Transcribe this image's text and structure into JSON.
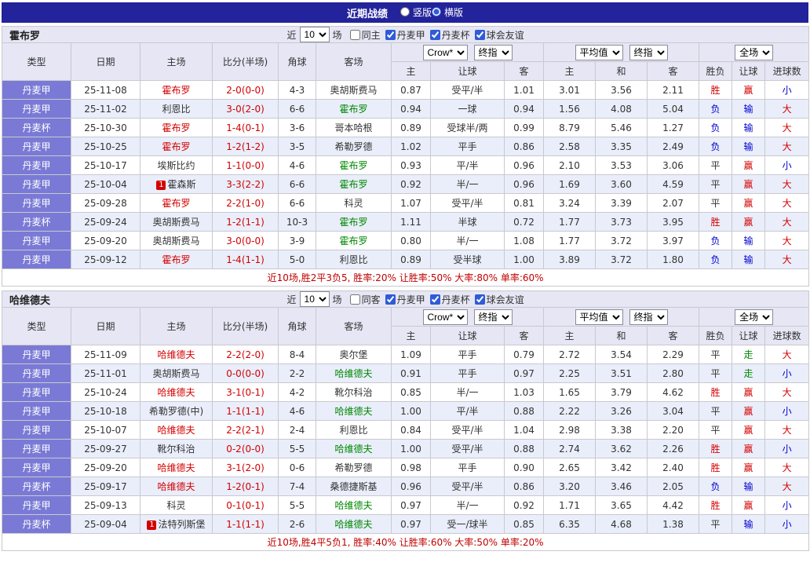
{
  "colors": {
    "topbar_bg": "#23239b",
    "type_cell_bg": "#7a7ad6",
    "header_bg": "#e6e6f4",
    "row_alt_bg": "#e9eefa",
    "red": "#d40000",
    "blue": "#0000cc",
    "green": "#008800",
    "dark": "#333333",
    "summary": "#c00000"
  },
  "topbar": {
    "title": "近期战绩",
    "radios": [
      {
        "label": "竖版",
        "checked": false
      },
      {
        "label": "横版",
        "checked": true
      }
    ]
  },
  "tables": [
    {
      "team": "霍布罗",
      "filter": {
        "prefix": "近",
        "count": "10",
        "suffix": "场",
        "checkboxes": [
          {
            "label": "同主",
            "checked": false
          },
          {
            "label": "丹麦甲",
            "checked": true
          },
          {
            "label": "丹麦杯",
            "checked": true
          },
          {
            "label": "球会友谊",
            "checked": true
          }
        ]
      },
      "selects": {
        "company": "Crow*",
        "company_time": "终指",
        "avg": "平均值",
        "avg_time": "终指",
        "scope": "全场"
      },
      "columns": [
        "类型",
        "日期",
        "主场",
        "比分(半场)",
        "角球",
        "客场"
      ],
      "sub_columns": [
        "主",
        "让球",
        "客",
        "主",
        "和",
        "客",
        "胜负",
        "让球",
        "进球数"
      ],
      "rows": [
        {
          "league": "丹麦甲",
          "date": "25-11-08",
          "home": "霍布罗",
          "home_color": "red",
          "home_badge": "",
          "score": "2-0(0-0)",
          "corner": "4-3",
          "away": "奥胡斯费马",
          "away_color": "dark",
          "asia": [
            "0.87",
            "受平/半",
            "1.01"
          ],
          "euro": [
            "3.01",
            "3.56",
            "2.11"
          ],
          "result": {
            "text": "胜",
            "color": "red"
          },
          "handicap": {
            "text": "赢",
            "color": "red"
          },
          "goals": {
            "text": "小",
            "color": "blue"
          }
        },
        {
          "league": "丹麦甲",
          "date": "25-11-02",
          "home": "利恩比",
          "home_color": "dark",
          "home_badge": "",
          "score": "3-0(2-0)",
          "corner": "6-6",
          "away": "霍布罗",
          "away_color": "green",
          "asia": [
            "0.94",
            "一球",
            "0.94"
          ],
          "euro": [
            "1.56",
            "4.08",
            "5.04"
          ],
          "result": {
            "text": "负",
            "color": "blue"
          },
          "handicap": {
            "text": "输",
            "color": "blue"
          },
          "goals": {
            "text": "大",
            "color": "red"
          }
        },
        {
          "league": "丹麦杯",
          "date": "25-10-30",
          "home": "霍布罗",
          "home_color": "red",
          "home_badge": "",
          "score": "1-4(0-1)",
          "corner": "3-6",
          "away": "哥本哈根",
          "away_color": "dark",
          "asia": [
            "0.89",
            "受球半/两",
            "0.99"
          ],
          "euro": [
            "8.79",
            "5.46",
            "1.27"
          ],
          "result": {
            "text": "负",
            "color": "blue"
          },
          "handicap": {
            "text": "输",
            "color": "blue"
          },
          "goals": {
            "text": "大",
            "color": "red"
          }
        },
        {
          "league": "丹麦甲",
          "date": "25-10-25",
          "home": "霍布罗",
          "home_color": "red",
          "home_badge": "",
          "score": "1-2(1-2)",
          "corner": "3-5",
          "away": "希勒罗德",
          "away_color": "dark",
          "asia": [
            "1.02",
            "平手",
            "0.86"
          ],
          "euro": [
            "2.58",
            "3.35",
            "2.49"
          ],
          "result": {
            "text": "负",
            "color": "blue"
          },
          "handicap": {
            "text": "输",
            "color": "blue"
          },
          "goals": {
            "text": "大",
            "color": "red"
          }
        },
        {
          "league": "丹麦甲",
          "date": "25-10-17",
          "home": "埃斯比约",
          "home_color": "dark",
          "home_badge": "",
          "score": "1-1(0-0)",
          "corner": "4-6",
          "away": "霍布罗",
          "away_color": "green",
          "asia": [
            "0.93",
            "平/半",
            "0.96"
          ],
          "euro": [
            "2.10",
            "3.53",
            "3.06"
          ],
          "result": {
            "text": "平",
            "color": "dark"
          },
          "handicap": {
            "text": "赢",
            "color": "red"
          },
          "goals": {
            "text": "小",
            "color": "blue"
          }
        },
        {
          "league": "丹麦甲",
          "date": "25-10-04",
          "home": "霍森斯",
          "home_color": "dark",
          "home_badge": "1",
          "score": "3-3(2-2)",
          "corner": "6-6",
          "away": "霍布罗",
          "away_color": "green",
          "asia": [
            "0.92",
            "半/一",
            "0.96"
          ],
          "euro": [
            "1.69",
            "3.60",
            "4.59"
          ],
          "result": {
            "text": "平",
            "color": "dark"
          },
          "handicap": {
            "text": "赢",
            "color": "red"
          },
          "goals": {
            "text": "大",
            "color": "red"
          }
        },
        {
          "league": "丹麦甲",
          "date": "25-09-28",
          "home": "霍布罗",
          "home_color": "red",
          "home_badge": "",
          "score": "2-2(1-0)",
          "corner": "6-6",
          "away": "科灵",
          "away_color": "dark",
          "asia": [
            "1.07",
            "受平/半",
            "0.81"
          ],
          "euro": [
            "3.24",
            "3.39",
            "2.07"
          ],
          "result": {
            "text": "平",
            "color": "dark"
          },
          "handicap": {
            "text": "赢",
            "color": "red"
          },
          "goals": {
            "text": "大",
            "color": "red"
          }
        },
        {
          "league": "丹麦杯",
          "date": "25-09-24",
          "home": "奥胡斯费马",
          "home_color": "dark",
          "home_badge": "",
          "score": "1-2(1-1)",
          "corner": "10-3",
          "away": "霍布罗",
          "away_color": "green",
          "asia": [
            "1.11",
            "半球",
            "0.72"
          ],
          "euro": [
            "1.77",
            "3.73",
            "3.95"
          ],
          "result": {
            "text": "胜",
            "color": "red"
          },
          "handicap": {
            "text": "赢",
            "color": "red"
          },
          "goals": {
            "text": "大",
            "color": "red"
          }
        },
        {
          "league": "丹麦甲",
          "date": "25-09-20",
          "home": "奥胡斯费马",
          "home_color": "dark",
          "home_badge": "",
          "score": "3-0(0-0)",
          "corner": "3-9",
          "away": "霍布罗",
          "away_color": "green",
          "asia": [
            "0.80",
            "半/一",
            "1.08"
          ],
          "euro": [
            "1.77",
            "3.72",
            "3.97"
          ],
          "result": {
            "text": "负",
            "color": "blue"
          },
          "handicap": {
            "text": "输",
            "color": "blue"
          },
          "goals": {
            "text": "大",
            "color": "red"
          }
        },
        {
          "league": "丹麦甲",
          "date": "25-09-12",
          "home": "霍布罗",
          "home_color": "red",
          "home_badge": "",
          "score": "1-4(1-1)",
          "corner": "5-0",
          "away": "利恩比",
          "away_color": "dark",
          "asia": [
            "0.89",
            "受半球",
            "1.00"
          ],
          "euro": [
            "3.89",
            "3.72",
            "1.80"
          ],
          "result": {
            "text": "负",
            "color": "blue"
          },
          "handicap": {
            "text": "输",
            "color": "blue"
          },
          "goals": {
            "text": "大",
            "color": "red"
          }
        }
      ],
      "summary": "近10场,胜2平3负5, 胜率:20% 让胜率:50% 大率:80% 单率:60%"
    },
    {
      "team": "哈维德夫",
      "filter": {
        "prefix": "近",
        "count": "10",
        "suffix": "场",
        "checkboxes": [
          {
            "label": "同客",
            "checked": false
          },
          {
            "label": "丹麦甲",
            "checked": true
          },
          {
            "label": "丹麦杯",
            "checked": true
          },
          {
            "label": "球会友谊",
            "checked": true
          }
        ]
      },
      "selects": {
        "company": "Crow*",
        "company_time": "终指",
        "avg": "平均值",
        "avg_time": "终指",
        "scope": "全场"
      },
      "columns": [
        "类型",
        "日期",
        "主场",
        "比分(半场)",
        "角球",
        "客场"
      ],
      "sub_columns": [
        "主",
        "让球",
        "客",
        "主",
        "和",
        "客",
        "胜负",
        "让球",
        "进球数"
      ],
      "rows": [
        {
          "league": "丹麦甲",
          "date": "25-11-09",
          "home": "哈维德夫",
          "home_color": "red",
          "home_badge": "",
          "score": "2-2(2-0)",
          "corner": "8-4",
          "away": "奥尔堡",
          "away_color": "dark",
          "asia": [
            "1.09",
            "平手",
            "0.79"
          ],
          "euro": [
            "2.72",
            "3.54",
            "2.29"
          ],
          "result": {
            "text": "平",
            "color": "dark"
          },
          "handicap": {
            "text": "走",
            "color": "green"
          },
          "goals": {
            "text": "大",
            "color": "red"
          }
        },
        {
          "league": "丹麦甲",
          "date": "25-11-01",
          "home": "奥胡斯费马",
          "home_color": "dark",
          "home_badge": "",
          "score": "0-0(0-0)",
          "corner": "2-2",
          "away": "哈维德夫",
          "away_color": "green",
          "asia": [
            "0.91",
            "平手",
            "0.97"
          ],
          "euro": [
            "2.25",
            "3.51",
            "2.80"
          ],
          "result": {
            "text": "平",
            "color": "dark"
          },
          "handicap": {
            "text": "走",
            "color": "green"
          },
          "goals": {
            "text": "小",
            "color": "blue"
          }
        },
        {
          "league": "丹麦甲",
          "date": "25-10-24",
          "home": "哈维德夫",
          "home_color": "red",
          "home_badge": "",
          "score": "3-1(0-1)",
          "corner": "4-2",
          "away": "靴尔科治",
          "away_color": "dark",
          "asia": [
            "0.85",
            "半/一",
            "1.03"
          ],
          "euro": [
            "1.65",
            "3.79",
            "4.62"
          ],
          "result": {
            "text": "胜",
            "color": "red"
          },
          "handicap": {
            "text": "赢",
            "color": "red"
          },
          "goals": {
            "text": "大",
            "color": "red"
          }
        },
        {
          "league": "丹麦甲",
          "date": "25-10-18",
          "home": "希勒罗德(中)",
          "home_color": "dark",
          "home_badge": "",
          "score": "1-1(1-1)",
          "corner": "4-6",
          "away": "哈维德夫",
          "away_color": "green",
          "asia": [
            "1.00",
            "平/半",
            "0.88"
          ],
          "euro": [
            "2.22",
            "3.26",
            "3.04"
          ],
          "result": {
            "text": "平",
            "color": "dark"
          },
          "handicap": {
            "text": "赢",
            "color": "red"
          },
          "goals": {
            "text": "小",
            "color": "blue"
          }
        },
        {
          "league": "丹麦甲",
          "date": "25-10-07",
          "home": "哈维德夫",
          "home_color": "red",
          "home_badge": "",
          "score": "2-2(2-1)",
          "corner": "2-4",
          "away": "利恩比",
          "away_color": "dark",
          "asia": [
            "0.84",
            "受平/半",
            "1.04"
          ],
          "euro": [
            "2.98",
            "3.38",
            "2.20"
          ],
          "result": {
            "text": "平",
            "color": "dark"
          },
          "handicap": {
            "text": "赢",
            "color": "red"
          },
          "goals": {
            "text": "大",
            "color": "red"
          }
        },
        {
          "league": "丹麦甲",
          "date": "25-09-27",
          "home": "靴尔科治",
          "home_color": "dark",
          "home_badge": "",
          "score": "0-2(0-0)",
          "corner": "5-5",
          "away": "哈维德夫",
          "away_color": "green",
          "asia": [
            "1.00",
            "受平/半",
            "0.88"
          ],
          "euro": [
            "2.74",
            "3.62",
            "2.26"
          ],
          "result": {
            "text": "胜",
            "color": "red"
          },
          "handicap": {
            "text": "赢",
            "color": "red"
          },
          "goals": {
            "text": "小",
            "color": "blue"
          }
        },
        {
          "league": "丹麦甲",
          "date": "25-09-20",
          "home": "哈维德夫",
          "home_color": "red",
          "home_badge": "",
          "score": "3-1(2-0)",
          "corner": "0-6",
          "away": "希勒罗德",
          "away_color": "dark",
          "asia": [
            "0.98",
            "平手",
            "0.90"
          ],
          "euro": [
            "2.65",
            "3.42",
            "2.40"
          ],
          "result": {
            "text": "胜",
            "color": "red"
          },
          "handicap": {
            "text": "赢",
            "color": "red"
          },
          "goals": {
            "text": "大",
            "color": "red"
          }
        },
        {
          "league": "丹麦杯",
          "date": "25-09-17",
          "home": "哈维德夫",
          "home_color": "red",
          "home_badge": "",
          "score": "1-2(0-1)",
          "corner": "7-4",
          "away": "桑德捷斯基",
          "away_color": "dark",
          "asia": [
            "0.96",
            "受平/半",
            "0.86"
          ],
          "euro": [
            "3.20",
            "3.46",
            "2.05"
          ],
          "result": {
            "text": "负",
            "color": "blue"
          },
          "handicap": {
            "text": "输",
            "color": "blue"
          },
          "goals": {
            "text": "大",
            "color": "red"
          }
        },
        {
          "league": "丹麦甲",
          "date": "25-09-13",
          "home": "科灵",
          "home_color": "dark",
          "home_badge": "",
          "score": "0-1(0-1)",
          "corner": "5-5",
          "away": "哈维德夫",
          "away_color": "green",
          "asia": [
            "0.97",
            "半/一",
            "0.92"
          ],
          "euro": [
            "1.71",
            "3.65",
            "4.42"
          ],
          "result": {
            "text": "胜",
            "color": "red"
          },
          "handicap": {
            "text": "赢",
            "color": "red"
          },
          "goals": {
            "text": "小",
            "color": "blue"
          }
        },
        {
          "league": "丹麦杯",
          "date": "25-09-04",
          "home": "法特列斯堡",
          "home_color": "dark",
          "home_badge": "1",
          "score": "1-1(1-1)",
          "corner": "2-6",
          "away": "哈维德夫",
          "away_color": "green",
          "asia": [
            "0.97",
            "受一/球半",
            "0.85"
          ],
          "euro": [
            "6.35",
            "4.68",
            "1.38"
          ],
          "result": {
            "text": "平",
            "color": "dark"
          },
          "handicap": {
            "text": "输",
            "color": "blue"
          },
          "goals": {
            "text": "小",
            "color": "blue"
          }
        }
      ],
      "summary": "近10场,胜4平5负1, 胜率:40% 让胜率:60% 大率:50% 单率:20%"
    }
  ]
}
